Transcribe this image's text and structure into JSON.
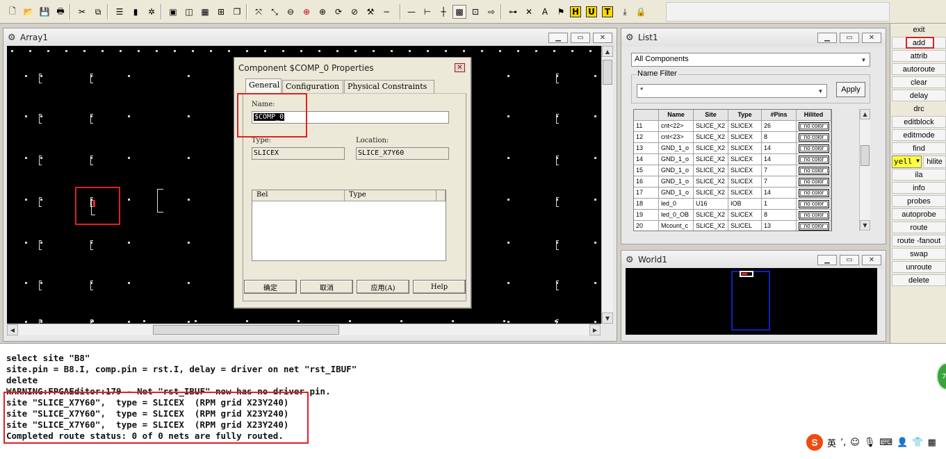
{
  "colors": {
    "highlight_red": "#e02020",
    "canvas_bg": "#000000",
    "world_frame": "#1020c0",
    "hilite_yellow": "#ffff40"
  },
  "toolbar": {
    "icons": [
      "new-file-icon",
      "open-folder-icon",
      "save-icon",
      "print-icon",
      "cut-icon",
      "copy-icon",
      "list-icon",
      "panel-icon",
      "sparkle-icon",
      "window-icon",
      "split-icon",
      "table-icon",
      "expand-icon",
      "layers-icon",
      "zoom-fit-icon",
      "zoom-full-icon",
      "zoom-out-icon",
      "zoom-in-red-icon",
      "zoom-in-icon",
      "refresh-icon",
      "stop-icon",
      "wrench-icon",
      "dash-icon",
      "line-icon",
      "bracket-icon",
      "junction-icon",
      "grid-icon",
      "chip-icon",
      "arrow-box-icon",
      "tree-icon",
      "cross-icon",
      "letter-a-icon",
      "flag-icon",
      "h-icon",
      "u-icon",
      "t-icon",
      "download-icon",
      "lock-icon"
    ]
  },
  "array_window": {
    "title": "Array1"
  },
  "list_window": {
    "title": "List1",
    "filter_select": "All Components",
    "name_filter_label": "Name Filter",
    "name_filter_value": "*",
    "apply_label": "Apply",
    "columns": [
      "",
      "Name",
      "Site",
      "Type",
      "#Pins",
      "Hilited"
    ],
    "rows": [
      [
        "11",
        "cnt<22>",
        "SLICE_X2",
        "SLICEX",
        "26",
        "no color"
      ],
      [
        "12",
        "cnt<23>",
        "SLICE_X2",
        "SLICEX",
        "8",
        "no color"
      ],
      [
        "13",
        "GND_1_o",
        "SLICE_X2",
        "SLICEX",
        "14",
        "no color"
      ],
      [
        "14",
        "GND_1_o",
        "SLICE_X2",
        "SLICEX",
        "14",
        "no color"
      ],
      [
        "15",
        "GND_1_o",
        "SLICE_X2",
        "SLICEX",
        "7",
        "no color"
      ],
      [
        "16",
        "GND_1_o",
        "SLICE_X2",
        "SLICEX",
        "7",
        "no color"
      ],
      [
        "17",
        "GND_1_o",
        "SLICE_X2",
        "SLICEX",
        "14",
        "no color"
      ],
      [
        "18",
        "led_0",
        "U16",
        "IOB",
        "1",
        "no color"
      ],
      [
        "19",
        "led_0_OB",
        "SLICE_X2",
        "SLICEX",
        "8",
        "no color"
      ],
      [
        "20",
        "Mcount_c",
        "SLICE_X2",
        "SLICEL",
        "13",
        "no color"
      ]
    ]
  },
  "world_window": {
    "title": "World1"
  },
  "dialog": {
    "title": "Component $COMP_0 Properties",
    "tabs": [
      "General",
      "Configuration",
      "Physical Constraints"
    ],
    "name_label": "Name:",
    "name_value": "$COMP_0",
    "type_label": "Type:",
    "type_value": "SLICEX",
    "location_label": "Location:",
    "location_value": "SLICE_X7Y60",
    "table_columns": [
      "Bel",
      "Type"
    ],
    "buttons": [
      "确定",
      "取消",
      "应用(A)",
      "Help"
    ]
  },
  "commands": {
    "items": [
      "exit",
      "add",
      "attrib",
      "autoroute",
      "clear",
      "delay",
      "drc",
      "editblock",
      "editmode",
      "find",
      "ila",
      "info",
      "probes",
      "autoprobe",
      "route",
      "route -fanout",
      "swap",
      "unroute",
      "delete"
    ],
    "color_select": "yell",
    "hilite_label": "hilite"
  },
  "console": {
    "lines": [
      "select site \"B8\"",
      "site.pin = B8.I, comp.pin = rst.I, delay = driver on net \"rst_IBUF\"",
      "delete",
      "WARNING:FPGAEditor:179 - Net \"rst_IBUF\" now has no driver pin.",
      "site \"SLICE_X7Y60\",  type = SLICEX  (RPM grid X23Y240)",
      "site \"SLICE_X7Y60\",  type = SLICEX  (RPM grid X23Y240)",
      "site \"SLICE_X7Y60\",  type = SLICEX  (RPM grid X23Y240)",
      "Completed route status: 0 of 0 nets are fully routed."
    ]
  },
  "tray": {
    "logo": "S",
    "lang": "英",
    "badge": "7"
  }
}
